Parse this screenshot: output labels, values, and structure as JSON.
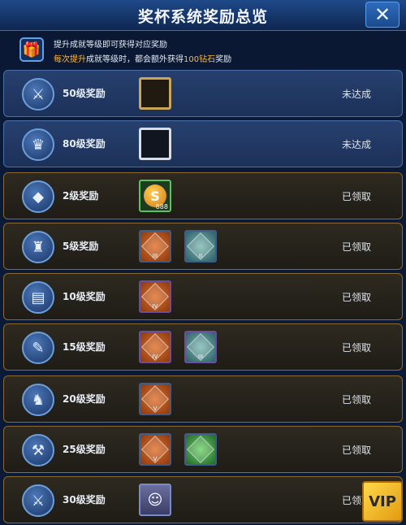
{
  "header": {
    "title": "奖杯系统奖励总览",
    "close_label": "✕"
  },
  "info": {
    "line1": "提升成就等级即可获得对应奖励",
    "line2_pre": "每次提升",
    "line2_mid": "成就等级时，都会额外获得",
    "line2_hl": "100钻石",
    "line2_post": "奖励"
  },
  "rows": [
    {
      "level": "50级奖励",
      "status": "未达成",
      "style": "blue",
      "badge": "⚔"
    },
    {
      "level": "80级奖励",
      "status": "未达成",
      "style": "blue",
      "badge": "♛"
    },
    {
      "level": "2级奖励",
      "status": "已领取",
      "style": "gold",
      "badge": "◆"
    },
    {
      "level": "5级奖励",
      "status": "已领取",
      "style": "gold",
      "badge": "♜"
    },
    {
      "level": "10级奖励",
      "status": "已领取",
      "style": "gold",
      "badge": "▤"
    },
    {
      "level": "15级奖励",
      "status": "已领取",
      "style": "gold",
      "badge": "✎"
    },
    {
      "level": "20级奖励",
      "status": "已领取",
      "style": "gold",
      "badge": "♞"
    },
    {
      "level": "25级奖励",
      "status": "已领取",
      "style": "gold",
      "badge": "⚒"
    },
    {
      "level": "30级奖励",
      "status": "已领取",
      "style": "gold",
      "badge": "⚔"
    }
  ],
  "items": {
    "coin_count": "888",
    "roman_ii": "II",
    "roman_iii": "III",
    "roman_iv": "IV",
    "roman_v": "V"
  },
  "vip_label": "VIP"
}
